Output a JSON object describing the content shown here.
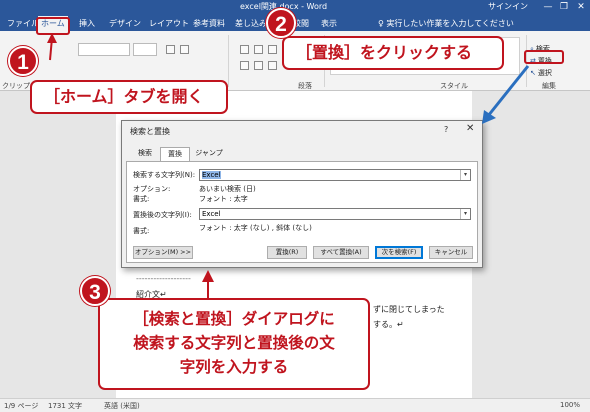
{
  "window": {
    "title": "excel関連.docx  -  Word",
    "signin": "サインイン",
    "minimize": "—",
    "restore": "❐",
    "close": "✕"
  },
  "tabs": [
    {
      "label": "ファイル"
    },
    {
      "label": "ホーム"
    },
    {
      "label": "挿入"
    },
    {
      "label": "デザイン"
    },
    {
      "label": "レイアウト"
    },
    {
      "label": "参考資料"
    },
    {
      "label": "差し込み"
    },
    {
      "label": "校閲"
    },
    {
      "label": "表示"
    }
  ],
  "tellme": "♀ 実行したい作業を入力してください",
  "ribbon": {
    "clipboard_label": "クリップボ",
    "paragraph_label": "段落",
    "style_label": "スタイル",
    "edit_label": "編集",
    "edit_find": "検索",
    "edit_replace": "置換",
    "edit_select": "選択"
  },
  "document": {
    "dashes": "-------------------",
    "intro": "紹介文↵",
    "line1": "ずに閉じてしまった",
    "line2": "する。↵"
  },
  "dialog": {
    "title": "検索と置換",
    "help": "?",
    "close": "✕",
    "tabs": [
      "検索",
      "置換",
      "ジャンプ"
    ],
    "find_label": "検索する文字列(N):",
    "find_value": "Excel",
    "find_option_label": "オプション:",
    "find_option_value": "あいまい検索 (日)",
    "find_format_label": "書式:",
    "find_format_value": "フォント : 太字",
    "replace_label": "置換後の文字列(I):",
    "replace_value": "Excel",
    "replace_format_label": "書式:",
    "replace_format_value": "フォント : 太字 (なし) , 斜体 (なし)",
    "btn_options": "オプション(M) >>",
    "btn_replace": "置換(R)",
    "btn_replace_all": "すべて置換(A)",
    "btn_find_next": "次を検索(F)",
    "btn_cancel": "キャンセル"
  },
  "statusbar": {
    "page": "1/9 ページ",
    "words": "1731 文字",
    "lang": "英語 (米国)",
    "zoom": "100%"
  },
  "callouts": {
    "step1_num": "1",
    "step1_text": "［ホーム］タブを開く",
    "step2_num": "2",
    "step2_text": "［置換］をクリックする",
    "step3_num": "3",
    "step3_line1": "［検索と置換］ダイアログに",
    "step3_line2": "検索する文字列と置換後の文",
    "step3_line3": "字列を入力する"
  },
  "colors": {
    "word_blue": "#2b579a",
    "callout_red": "#c0141e"
  }
}
